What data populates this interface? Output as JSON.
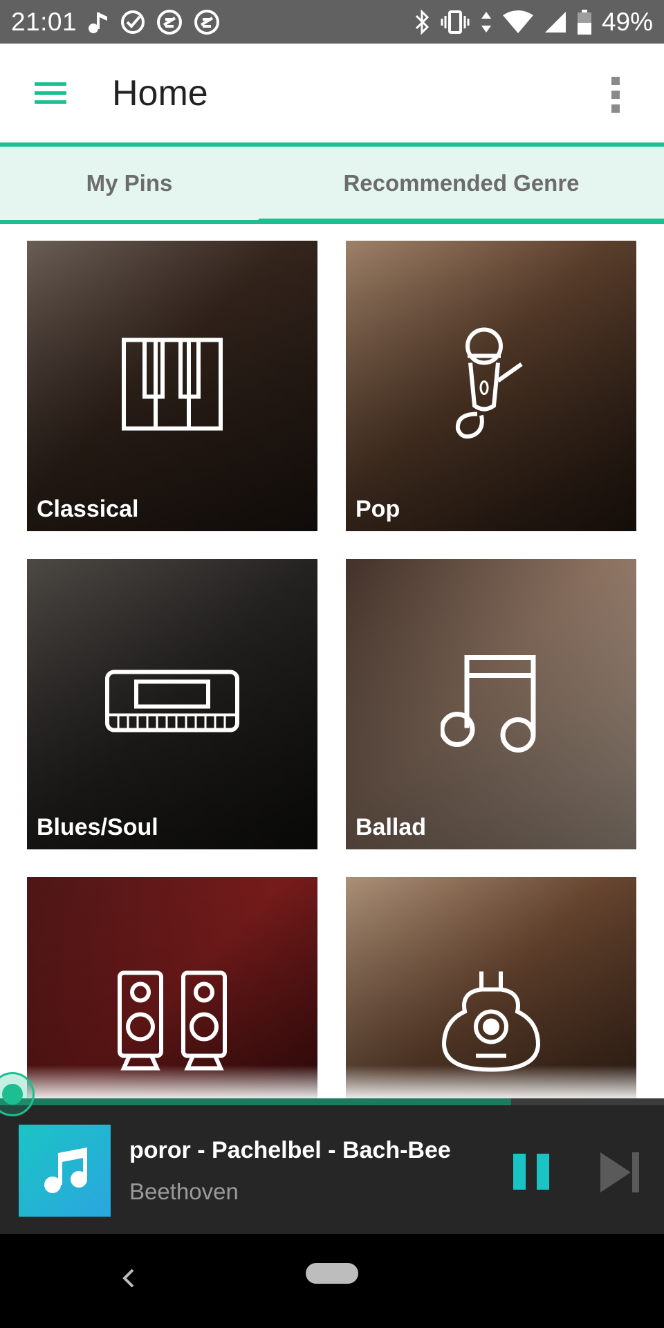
{
  "status_bar": {
    "time": "21:01",
    "battery_percent": "49%",
    "icons_left": [
      "music-note-icon",
      "check-circle-icon",
      "vpn-icon",
      "vpn-icon"
    ],
    "icons_right": [
      "bluetooth-icon",
      "vibrate-icon",
      "data-arrows-icon",
      "wifi-icon",
      "signal-icon",
      "battery-icon"
    ]
  },
  "app_bar": {
    "title": "Home",
    "menu_icon": "hamburger-menu-icon",
    "overflow_icon": "more-vert-icon"
  },
  "tabs": [
    {
      "label": "My Pins",
      "selected": false
    },
    {
      "label": "Recommended Genre",
      "selected": true
    }
  ],
  "genres": [
    {
      "label": "Classical",
      "icon": "piano-keys-icon"
    },
    {
      "label": "Pop",
      "icon": "microphone-icon"
    },
    {
      "label": "Blues/Soul",
      "icon": "keyboard-synth-icon"
    },
    {
      "label": "Ballad",
      "icon": "music-notes-icon"
    },
    {
      "label": "",
      "icon": "speakers-icon"
    },
    {
      "label": "",
      "icon": "acoustic-guitar-icon"
    }
  ],
  "player": {
    "title": "poror - Pachelbel - Bach-Bee",
    "artist": "Beethoven",
    "progress": 0.77,
    "album_icon": "music-note-icon",
    "play_state": "playing"
  },
  "colors": {
    "accent": "#1dbf91",
    "tab_background": "#e4f6ef",
    "status_bar": "#616161",
    "player_background": "#262626",
    "pause_button": "#1bc4c4"
  }
}
